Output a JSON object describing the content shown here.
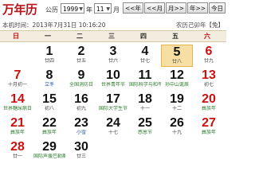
{
  "header": {
    "logo": "万年历",
    "calendar_label": "公历",
    "year_value": "1999",
    "year_unit": "年",
    "month_value": "11",
    "month_unit": "月",
    "buttons": [
      "<<年",
      "<<月",
      "月>>",
      "年>>",
      "今日"
    ]
  },
  "status": {
    "local_time": "本机时间：2013年7月31日 10:16:20",
    "lunar_info": "农历己卯年【兔】"
  },
  "weekdays": [
    "日",
    "一",
    "二",
    "三",
    "四",
    "五",
    "六"
  ],
  "days": [
    {
      "day": "",
      "sub": ""
    },
    {
      "day": "1",
      "sub": "廿四"
    },
    {
      "day": "2",
      "sub": "廿五"
    },
    {
      "day": "3",
      "sub": "廿六"
    },
    {
      "day": "4",
      "sub": "廿七"
    },
    {
      "day": "5",
      "sub": "廿八"
    },
    {
      "day": "6",
      "sub": "廿九"
    },
    {
      "day": "7",
      "sub": "十月初一"
    },
    {
      "day": "8",
      "sub": "立冬"
    },
    {
      "day": "9",
      "sub": "全国消防日"
    },
    {
      "day": "10",
      "sub": "世界青年节"
    },
    {
      "day": "11",
      "sub": "国际科学与和平周"
    },
    {
      "day": "12",
      "sub": "孙中山诞辰"
    },
    {
      "day": "13",
      "sub": "初七"
    },
    {
      "day": "14",
      "sub": "世界糖尿病日"
    },
    {
      "day": "15",
      "sub": "初八"
    },
    {
      "day": "16",
      "sub": "初九"
    },
    {
      "day": "17",
      "sub": "国际大学生节"
    },
    {
      "day": "18",
      "sub": "十一"
    },
    {
      "day": "19",
      "sub": "十二"
    },
    {
      "day": "20",
      "sub": "彝族年"
    },
    {
      "day": "21",
      "sub": "彝族年"
    },
    {
      "day": "22",
      "sub": "彝族年"
    },
    {
      "day": "23",
      "sub": "小雪"
    },
    {
      "day": "24",
      "sub": "十七"
    },
    {
      "day": "25",
      "sub": "感恩节"
    },
    {
      "day": "26",
      "sub": "十九"
    },
    {
      "day": "27",
      "sub": "彝族年"
    },
    {
      "day": "28",
      "sub": "廿一"
    },
    {
      "day": "29",
      "sub": "国际声援巴勒斯坦"
    },
    {
      "day": "30",
      "sub": "廿三"
    }
  ],
  "today_day": "5"
}
